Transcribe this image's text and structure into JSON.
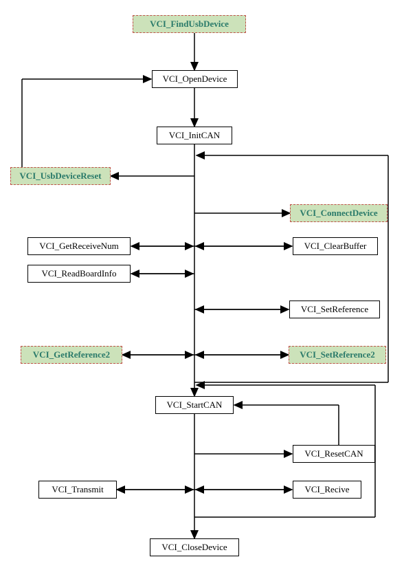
{
  "nodes": {
    "find": "VCI_FindUsbDevice",
    "open": "VCI_OpenDevice",
    "init": "VCI_InitCAN",
    "reset_usb": "VCI_UsbDeviceReset",
    "connect": "VCI_ConnectDevice",
    "getnum": "VCI_GetReceiveNum",
    "clear": "VCI_ClearBuffer",
    "readboard": "VCI_ReadBoardInfo",
    "setref": "VCI_SetReference",
    "getref2": "VCI_GetReference2",
    "setref2": "VCI_SetReference2",
    "start": "VCI_StartCAN",
    "resetcan": "VCI_ResetCAN",
    "transmit": "VCI_Transmit",
    "recive": "VCI_Recive",
    "close": "VCI_CloseDevice"
  }
}
